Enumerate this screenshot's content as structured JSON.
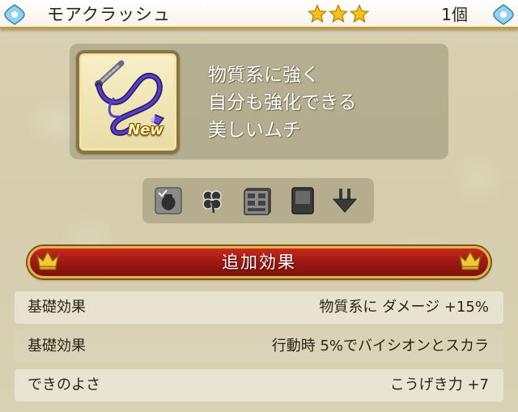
{
  "header": {
    "title": "モアクラッシュ",
    "rarity_stars": 3,
    "count": "1個"
  },
  "item": {
    "icon": "purple-whip-icon",
    "badge": "New",
    "description_lines": [
      "物質系に強く",
      "自分も強化できる",
      "美しいムチ"
    ]
  },
  "attributes": [
    {
      "icon": "pouch-sell-icon"
    },
    {
      "icon": "clover-icon"
    },
    {
      "icon": "storage-drawers-icon"
    },
    {
      "icon": "card-icon"
    },
    {
      "icon": "down-arrow-transfer-icon"
    }
  ],
  "section": {
    "title": "追加効果"
  },
  "stats": [
    {
      "key": "基礎効果",
      "value": "物質系に ダメージ +15%"
    },
    {
      "key": "基礎効果",
      "value": "行動時 5%でバイシオンとスカラ"
    },
    {
      "key": "できのよさ",
      "value": "こうげき力 +7"
    }
  ],
  "colors": {
    "ribbon_red": "#9c1912",
    "gold_trim": "#e3b04a",
    "star_gold": "#f5c21a"
  }
}
